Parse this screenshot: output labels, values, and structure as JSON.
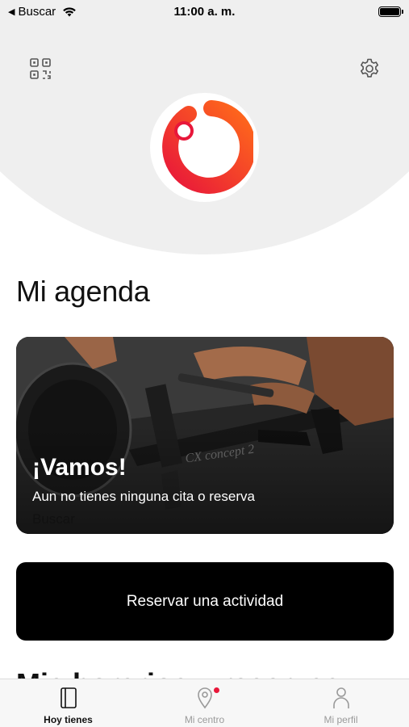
{
  "status_bar": {
    "back_label": "Buscar",
    "time": "11:00 a. m."
  },
  "header": {
    "left_icon": "qr-code-icon",
    "right_icon": "gear-icon",
    "logo_icon": "brand-ring-logo",
    "logo_colors": [
      "#e8173a",
      "#ff6b1a"
    ]
  },
  "agenda": {
    "title": "Mi agenda",
    "card": {
      "title": "¡Vamos!",
      "subtitle": "Aun no tienes ninguna cita o reserva",
      "link": "Buscar"
    },
    "cta_label": "Reservar una actividad"
  },
  "next_section": {
    "title": "Mis horarios y reservas"
  },
  "tab_bar": {
    "tabs": [
      {
        "label": "Hoy tienes",
        "icon": "book-icon",
        "active": true
      },
      {
        "label": "Mi centro",
        "icon": "location-pin-icon",
        "active": false,
        "badge": true
      },
      {
        "label": "Mi perfil",
        "icon": "person-icon",
        "active": false
      }
    ],
    "badge_color": "#e8173a"
  }
}
